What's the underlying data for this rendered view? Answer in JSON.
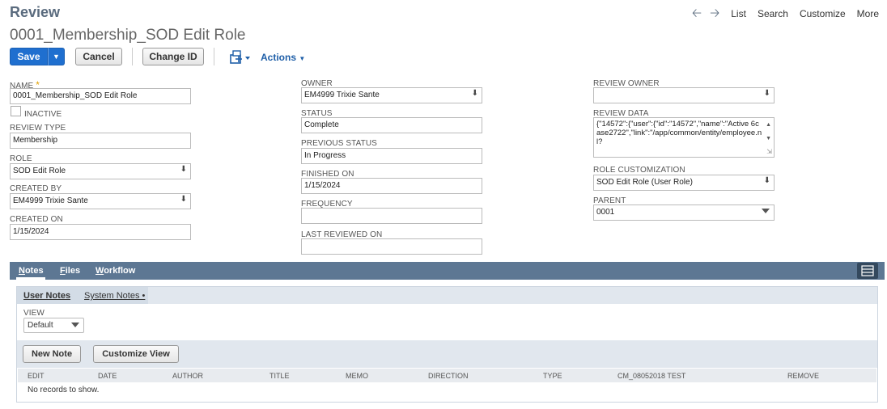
{
  "header": {
    "page_type": "Review",
    "record_title": "0001_Membership_SOD Edit Role"
  },
  "topnav": {
    "back_icon": "arrow-left-icon",
    "forward_icon": "arrow-right-icon",
    "links": [
      "List",
      "Search",
      "Customize",
      "More"
    ]
  },
  "toolbar": {
    "save_label": "Save",
    "cancel_label": "Cancel",
    "change_id_label": "Change ID",
    "actions_label": "Actions"
  },
  "form": {
    "name": {
      "label": "NAME",
      "required_mark": "*",
      "value": "0001_Membership_SOD Edit Role"
    },
    "inactive": {
      "label": "INACTIVE",
      "checked": false
    },
    "review_type": {
      "label": "REVIEW TYPE",
      "value": "Membership"
    },
    "role": {
      "label": "ROLE",
      "value": "SOD Edit Role"
    },
    "created_by": {
      "label": "CREATED BY",
      "value": "EM4999 Trixie Sante"
    },
    "created_on": {
      "label": "CREATED ON",
      "value": "1/15/2024"
    },
    "owner": {
      "label": "OWNER",
      "value": "EM4999 Trixie Sante"
    },
    "status": {
      "label": "STATUS",
      "value": "Complete"
    },
    "previous_status": {
      "label": "PREVIOUS STATUS",
      "value": "In Progress"
    },
    "finished_on": {
      "label": "FINISHED ON",
      "value": "1/15/2024"
    },
    "frequency": {
      "label": "FREQUENCY",
      "value": ""
    },
    "last_reviewed_on": {
      "label": "LAST REVIEWED ON",
      "value": ""
    },
    "review_owner": {
      "label": "REVIEW OWNER",
      "value": ""
    },
    "review_data": {
      "label": "REVIEW DATA",
      "value": "{\"14572\":{\"user\":{\"id\":\"14572\",\"name\":\"Active 6case2722\",\"link\":\"/app/common/entity/employee.nl?"
    },
    "role_customization": {
      "label": "ROLE CUSTOMIZATION",
      "value": "SOD Edit Role (User Role)"
    },
    "parent": {
      "label": "PARENT",
      "value": "0001"
    }
  },
  "tabs": [
    {
      "label": "Notes",
      "active": true
    },
    {
      "label": "Files",
      "active": false
    },
    {
      "label": "Workflow",
      "active": false
    }
  ],
  "notes": {
    "subtabs": [
      {
        "label": "User Notes",
        "active": true
      },
      {
        "label": "System Notes •",
        "active": false
      }
    ],
    "view": {
      "label": "VIEW",
      "value": "Default"
    },
    "new_note_label": "New Note",
    "customize_view_label": "Customize View",
    "columns": [
      "EDIT",
      "DATE",
      "AUTHOR",
      "TITLE",
      "MEMO",
      "DIRECTION",
      "TYPE",
      "CM_08052018 TEST",
      "REMOVE"
    ],
    "empty_text": "No records to show."
  },
  "colors": {
    "primary_button": "#1f6fcf",
    "tab_bar": "#5d7793",
    "page_type": "#5a6b7e"
  }
}
